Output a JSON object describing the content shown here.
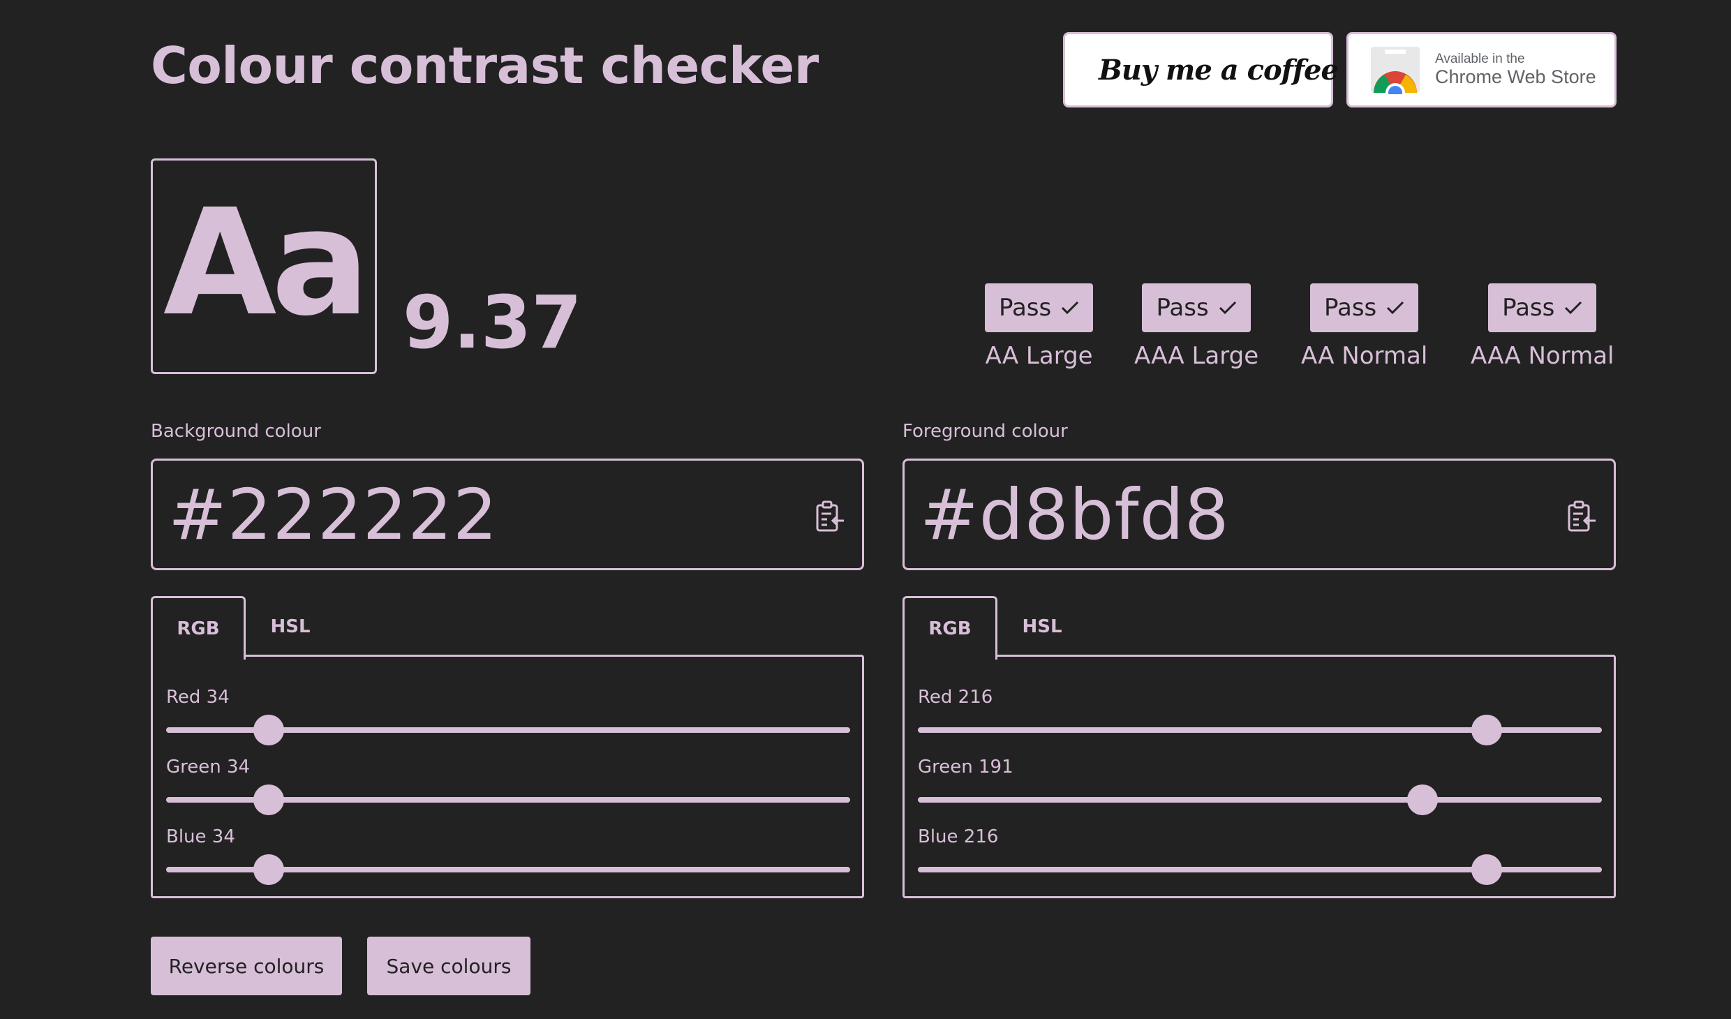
{
  "title": "Colour contrast checker",
  "badges": {
    "coffee_label": "Buy me a coffee",
    "chrome_small": "Available in the",
    "chrome_big": "Chrome Web Store"
  },
  "preview": {
    "sample_text": "Aa"
  },
  "ratio": "9.37",
  "results": [
    {
      "status": "Pass",
      "level": "AA Large"
    },
    {
      "status": "Pass",
      "level": "AAA Large"
    },
    {
      "status": "Pass",
      "level": "AA Normal"
    },
    {
      "status": "Pass",
      "level": "AAA Normal"
    }
  ],
  "background": {
    "label": "Background colour",
    "hex": "#222222",
    "tabs": [
      "RGB",
      "HSL"
    ],
    "active_tab": "RGB",
    "sliders": [
      {
        "label": "Red 34",
        "value": 34,
        "max": 255
      },
      {
        "label": "Green 34",
        "value": 34,
        "max": 255
      },
      {
        "label": "Blue 34",
        "value": 34,
        "max": 255
      }
    ]
  },
  "foreground": {
    "label": "Foreground colour",
    "hex": "#d8bfd8",
    "tabs": [
      "RGB",
      "HSL"
    ],
    "active_tab": "RGB",
    "sliders": [
      {
        "label": "Red 216",
        "value": 216,
        "max": 255
      },
      {
        "label": "Green 191",
        "value": 191,
        "max": 255
      },
      {
        "label": "Blue 216",
        "value": 216,
        "max": 255
      }
    ]
  },
  "actions": {
    "reverse_label": "Reverse colours",
    "save_label": "Save colours"
  },
  "colors": {
    "background": "#222222",
    "accent": "#d8bfd8"
  },
  "icons": {
    "check": "check-icon",
    "paste": "paste-icon",
    "coffee": "coffee-cup-icon",
    "chrome": "chrome-logo-icon"
  }
}
